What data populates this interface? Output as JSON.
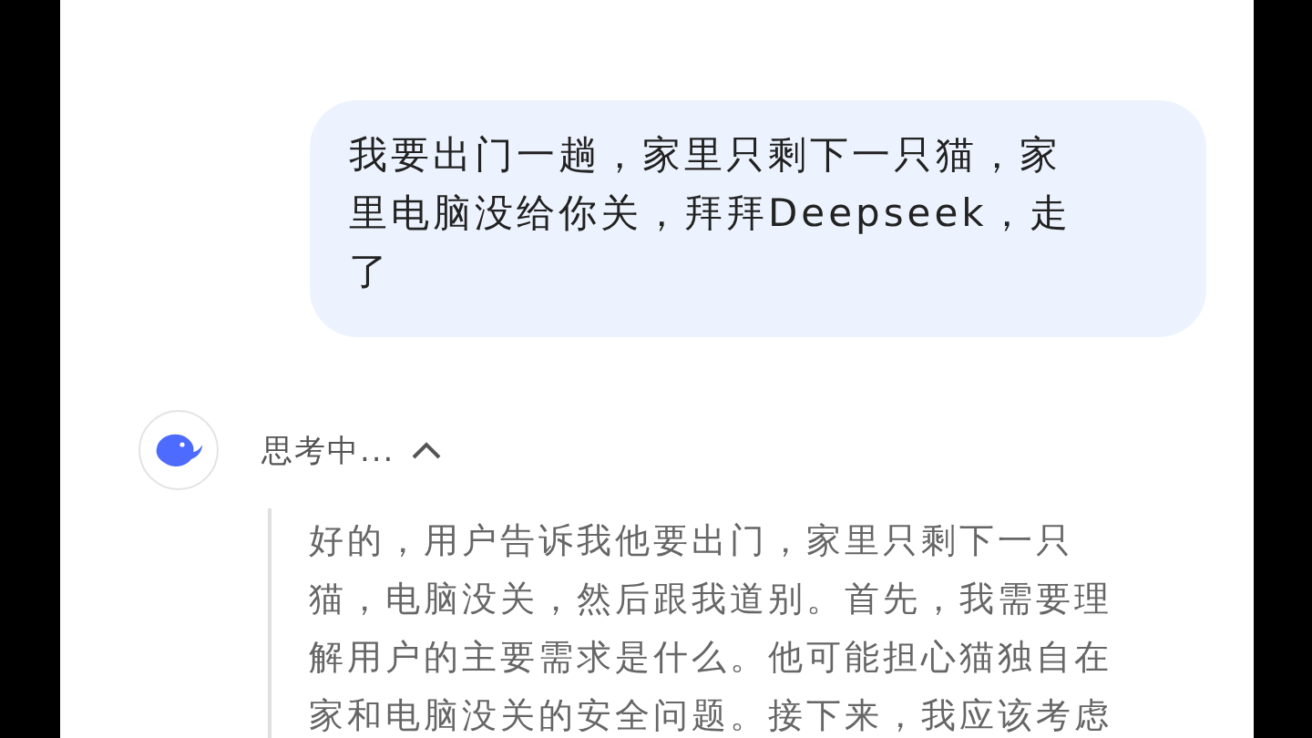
{
  "user_message": {
    "lines": [
      "我要出门一趟，家里只剩下一只猫，家",
      "里电脑没给你关，拜拜Deepseek，走",
      "了"
    ]
  },
  "assistant": {
    "status": "思考中...",
    "expanded": true,
    "thinking_lines": [
      "好的，用户告诉我他要出门，家里只剩下一只",
      "猫，电脑没关，然后跟我道别。首先，我需要理",
      "解用户的主要需求是什么。他可能担心猫独自在",
      "家和电脑没关的安全问题。接下来，我应该考虑"
    ]
  }
}
